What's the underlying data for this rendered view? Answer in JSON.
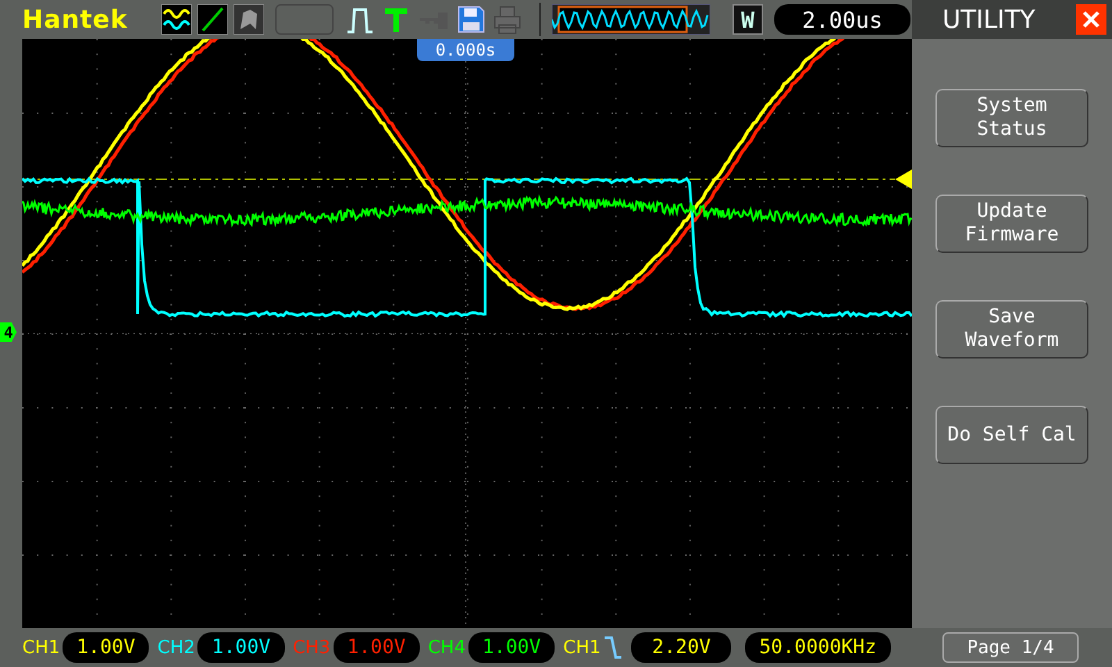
{
  "header": {
    "brand": "Hantek",
    "mode": "W",
    "timebase": "2.00us"
  },
  "trigger_position": "0.000s",
  "ground_marker": "4",
  "channels": [
    {
      "label": "CH1",
      "scale": "1.00V",
      "color": "#ffff00"
    },
    {
      "label": "CH2",
      "scale": "1.00V",
      "color": "#00ffff"
    },
    {
      "label": "CH3",
      "scale": "1.00V",
      "color": "#ff2000"
    },
    {
      "label": "CH4",
      "scale": "1.00V",
      "color": "#00ff00"
    }
  ],
  "trigger": {
    "source": "CH1",
    "level": "2.20V",
    "frequency": "50.0000KHz"
  },
  "menu": {
    "title": "UTILITY",
    "buttons": [
      {
        "lines": [
          "System",
          "Status"
        ]
      },
      {
        "lines": [
          "Update",
          "Firmware"
        ]
      },
      {
        "lines": [
          "Save",
          "Waveform"
        ]
      },
      {
        "lines": [
          "Do Self Cal"
        ]
      }
    ],
    "page": "Page 1/4"
  }
}
